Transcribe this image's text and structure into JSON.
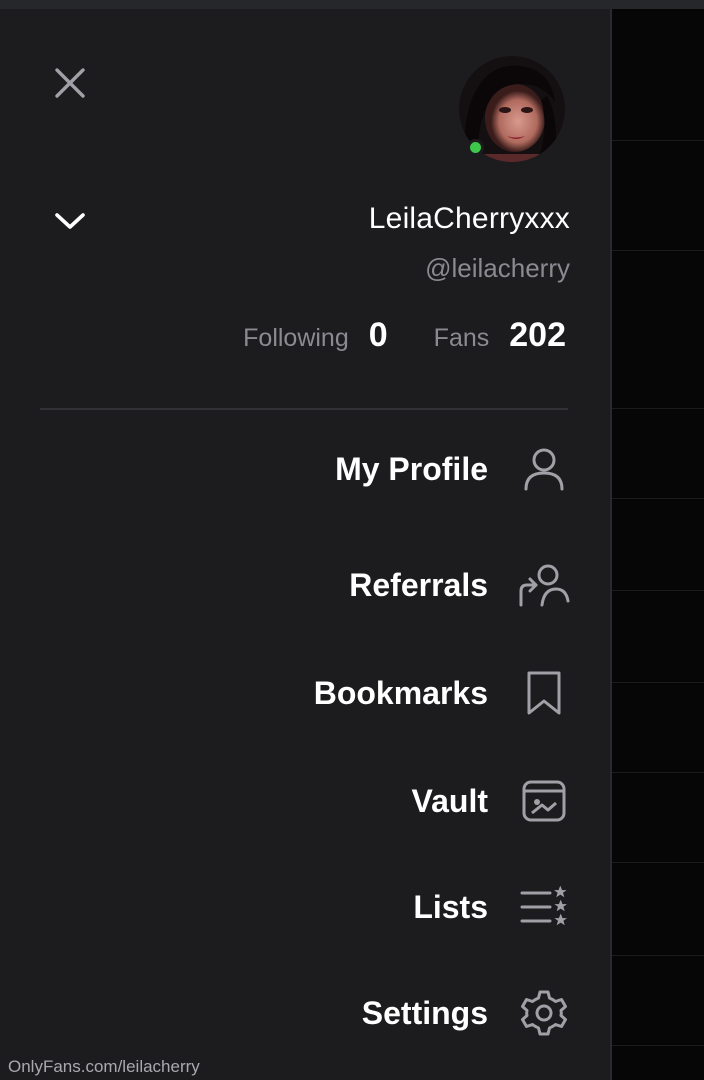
{
  "profile": {
    "display_name": "LeilaCherryxxx",
    "handle": "@leilacherry",
    "online": true
  },
  "stats": {
    "fans_count": "202",
    "fans_label": "Fans",
    "following_count": "0",
    "following_label": "Following"
  },
  "menu": {
    "items": [
      {
        "label": "My Profile",
        "icon": "user-icon"
      },
      {
        "label": "Referrals",
        "icon": "referrals-icon"
      },
      {
        "label": "Bookmarks",
        "icon": "bookmark-icon"
      },
      {
        "label": "Vault",
        "icon": "vault-icon"
      },
      {
        "label": "Lists",
        "icon": "lists-icon"
      },
      {
        "label": "Settings",
        "icon": "gear-icon"
      }
    ]
  },
  "footer": {
    "watermark": "OnlyFans.com/leilacherry"
  },
  "colors": {
    "panel_bg": "#1c1c1f",
    "page_bg": "#0a0a0b",
    "text_primary": "#ffffff",
    "text_secondary": "#8a8a90",
    "online_green": "#3ec74b"
  }
}
